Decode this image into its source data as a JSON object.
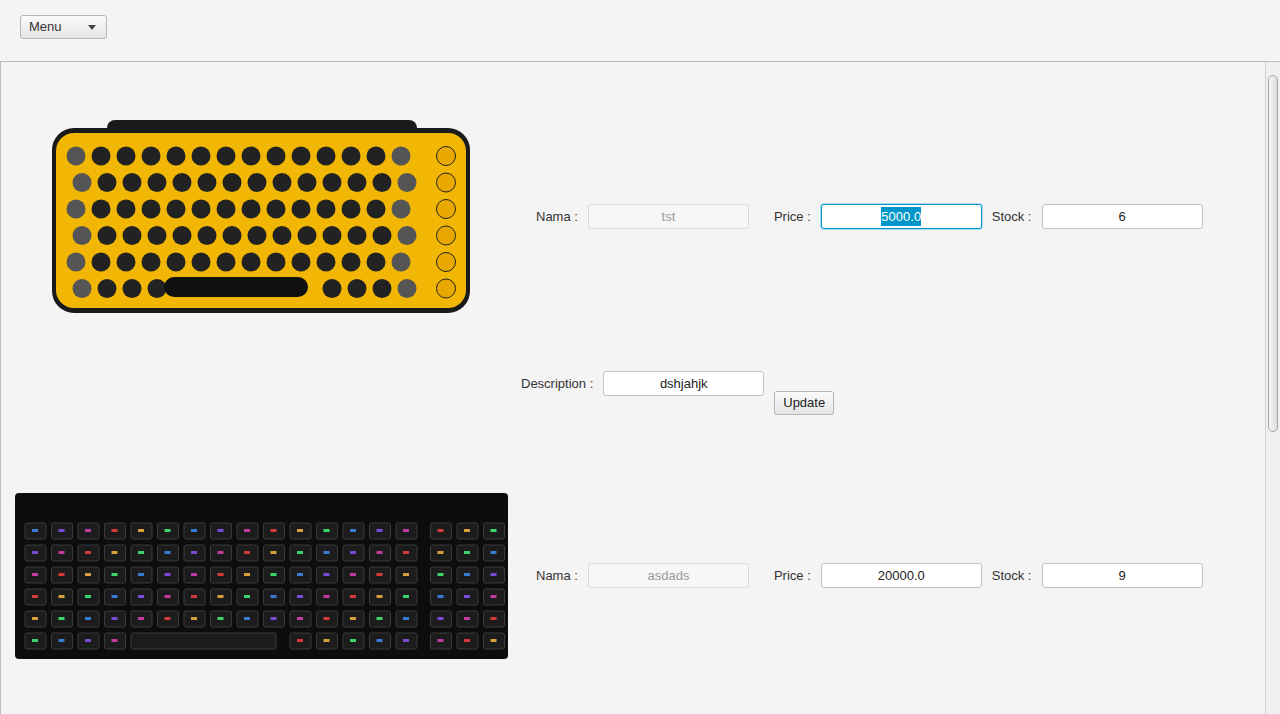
{
  "menu": {
    "label": "Menu"
  },
  "labels": {
    "name": "Nama :",
    "price": "Price :",
    "stock": "Stock :",
    "description": "Description :"
  },
  "update_button": "Update",
  "products": [
    {
      "name": "tst",
      "name_disabled": true,
      "price": "5000.0",
      "price_selected": true,
      "stock": "6",
      "description": "dshjahjk",
      "photo_color": "#f2b705"
    },
    {
      "name": "asdads",
      "name_disabled": true,
      "price": "20000.0",
      "price_selected": false,
      "stock": "9",
      "photo_color": "#0d0d0d"
    }
  ],
  "scrollbar": {
    "level": 0.57
  }
}
